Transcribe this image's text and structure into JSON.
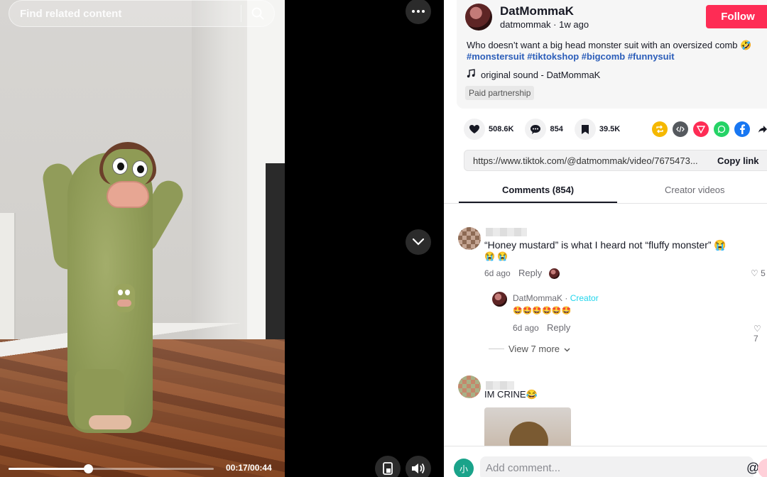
{
  "video": {
    "search_placeholder": "Find related content",
    "time": "00:17/00:44",
    "progress": 0.386
  },
  "post": {
    "author_name": "DatMommaK",
    "author_handle": "datmommak",
    "author_dot": "·",
    "posted_ago": "1w ago",
    "follow_label": "Follow",
    "description": "Who doesn’t want a big head monster suit with an oversized comb 🤣",
    "hashtags": "#monstersuit #tiktokshop #bigcomb #funnysuit",
    "sound": "original sound - DatMommaK",
    "paid_label": "Paid partnership"
  },
  "stats": {
    "likes": "508.6K",
    "comments": "854",
    "saves": "39.5K"
  },
  "share_icons": [
    "repost-icon",
    "embed-icon",
    "send-icon",
    "whatsapp-icon",
    "facebook-icon",
    "share-arrow-icon"
  ],
  "link": {
    "url": "https://www.tiktok.com/@datmommak/video/7675473...",
    "copy_label": "Copy link"
  },
  "tabs": {
    "comments": "Comments (854)",
    "creator_videos": "Creator videos"
  },
  "comments": [
    {
      "text": "“Honey mustard” is what I heard not “fluffy monster” 😭",
      "text_line2": "😭 😭",
      "age": "6d ago",
      "reply_label": "Reply",
      "likes": "5"
    }
  ],
  "creator_reply": {
    "name": "DatMommaK",
    "sep": "·",
    "tag": "Creator",
    "emojis": "🤩🤩🤩🤩🤩🤩",
    "age": "6d ago",
    "reply_label": "Reply",
    "likes": "7"
  },
  "view_more": "View 7 more",
  "comment2": {
    "text": "IM CRINE😂"
  },
  "composer": {
    "avatar_letter": "小",
    "placeholder": "Add comment...",
    "at": "@",
    "emoji": "☺"
  },
  "colors": {
    "follow": "#fe2c55",
    "hashtag": "#2b5db9",
    "creator_tag": "#20d5ec"
  }
}
